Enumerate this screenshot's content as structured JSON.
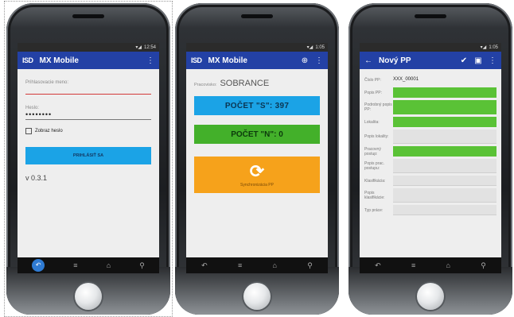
{
  "login": {
    "status_time": "12:54",
    "app_title": "MX Mobile",
    "logo": "ISD",
    "username_label": "Prihlasovacie meno:",
    "username_value": "",
    "password_label": "Heslo:",
    "password_value": "••••••••",
    "show_password_label": "Zobraz heslo",
    "login_button": "PRIHLÁSIŤ SA",
    "version": "v 0.3.1"
  },
  "sync": {
    "status_time": "1:05",
    "app_title": "MX Mobile",
    "logo": "ISD",
    "workplace_label": "Pracovisko:",
    "workplace_value": "SOBRANCE",
    "count_s": "POČET \"S\": 397",
    "count_n": "POČET \"N\": 0",
    "sync_caption": "Synchronizácia PP"
  },
  "form": {
    "status_time": "1:05",
    "title": "Nový PP",
    "fields": [
      {
        "label": "Číslo PP:",
        "value": "XXX_00001",
        "style": "text"
      },
      {
        "label": "Popis PP:",
        "value": "",
        "style": "green"
      },
      {
        "label": "Podrobný popis PP:",
        "value": "",
        "style": "green"
      },
      {
        "label": "Lokalita:",
        "value": "",
        "style": "green"
      },
      {
        "label": "Popis lokality:",
        "value": "",
        "style": "gray"
      },
      {
        "label": "Pracovný postup:",
        "value": "",
        "style": "green"
      },
      {
        "label": "Popis prac. postupu:",
        "value": "",
        "style": "gray"
      },
      {
        "label": "Klasifikácia:",
        "value": "",
        "style": "gray"
      },
      {
        "label": "Popis klasifikácie:",
        "value": "",
        "style": "gray"
      },
      {
        "label": "Typ práce:",
        "value": "",
        "style": "gray"
      }
    ]
  },
  "icons": {
    "menu": "⋮",
    "add": "⊕",
    "back": "←",
    "check": "✔",
    "save": "▣",
    "nav_back": "↶",
    "nav_menu": "≡",
    "nav_home": "⌂",
    "nav_search": "⚲",
    "sync": "⟳"
  },
  "colors": {
    "appbar": "#2341a5",
    "blue_button": "#1ba3e6",
    "green": "#43b02a",
    "orange": "#f6a21b",
    "error_underline": "#d33a3a"
  }
}
